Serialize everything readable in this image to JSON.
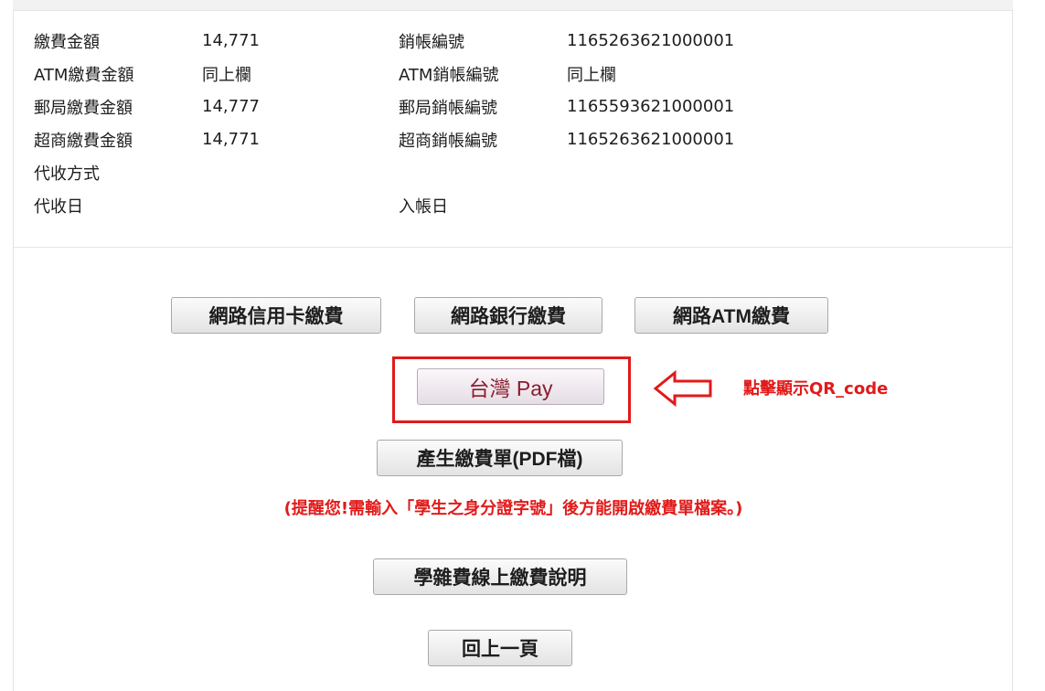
{
  "details": {
    "rows": [
      {
        "label_left": "繳費金額",
        "value_left": "14,771",
        "label_right": "銷帳編號",
        "value_right": "1165263621000001"
      },
      {
        "label_left": "ATM繳費金額",
        "value_left": "同上欄",
        "label_right": "ATM銷帳編號",
        "value_right": "同上欄"
      },
      {
        "label_left": "郵局繳費金額",
        "value_left": "14,777",
        "label_right": "郵局銷帳編號",
        "value_right": "1165593621000001"
      },
      {
        "label_left": "超商繳費金額",
        "value_left": "14,771",
        "label_right": "超商銷帳編號",
        "value_right": "1165263621000001"
      },
      {
        "label_left": "代收方式",
        "value_left": "",
        "label_right": "",
        "value_right": ""
      },
      {
        "label_left": "代收日",
        "value_left": "",
        "label_right": "入帳日",
        "value_right": ""
      }
    ]
  },
  "buttons": {
    "credit_card": "網路信用卡繳費",
    "online_bank": "網路銀行繳費",
    "online_atm": "網路ATM繳費",
    "taiwan_pay": "台灣 Pay",
    "generate_pdf": "產生繳費單(PDF檔)",
    "instructions": "學雜費線上繳費說明",
    "back": "回上一頁"
  },
  "annotation": {
    "hint_text": "點擊顯示QR_code",
    "color": "#e11a1a"
  },
  "reminder": "(提醒您!需輸入「學生之身分證字號」後方能開啟繳費單檔案。)"
}
